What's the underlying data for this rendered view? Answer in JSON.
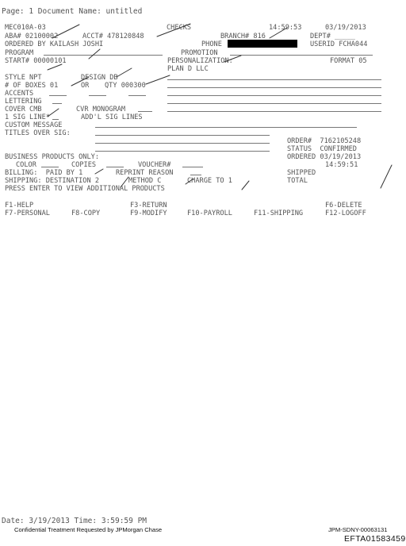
{
  "page_header": "Page: 1 Document Name: untitled",
  "screen": {
    "screen_id": "MEC010A-03",
    "section": "CHECKS",
    "time": "14:59:53",
    "date": "03/19/2013",
    "aba": "ABA# 02100002",
    "acct": "ACCT# 478120848",
    "branch": "BRANCH# 816",
    "dept": "DEPT# _____",
    "ordered_by": "ORDERED BY KAILASH JOSHI",
    "phone_label": "PHONE",
    "userid": "USERID FCHA044",
    "program": "PROGRAM",
    "promotion": "PROMOTION",
    "start": "START# 00000101",
    "personalization": "PERSONALIZATION:",
    "format": "FORMAT 05",
    "plan": "PLAN D LLC",
    "style": "STYLE NPT",
    "design": "DESIGN DB",
    "boxes": "# OF BOXES 01",
    "or": "OR",
    "qty": "QTY 000300",
    "accents": "ACCENTS",
    "lettering": "LETTERING",
    "cover": "COVER CMB",
    "monogram": "CVR MONOGRAM",
    "sig_line": "1 SIG LINE*",
    "addl_sig": "ADD'L SIG LINES",
    "custom_message": "CUSTOM MESSAGE",
    "titles_over_sig": "TITLES OVER SIG:",
    "order_num": "ORDER#  7162105248",
    "status": "STATUS  CONFIRMED",
    "ordered": "ORDERED 03/19/2013",
    "ordered_time": "14:59:51",
    "shipped": "SHIPPED",
    "total": "TOTAL",
    "business_products": "BUSINESS PRODUCTS ONLY:",
    "color": "COLOR",
    "copies": "COPIES",
    "voucher": "VOUCHER#",
    "billing": "BILLING:  PAID BY 1",
    "reprint": "REPRINT REASON",
    "shipping": "SHIPPING: DESTINATION 2",
    "method": "METHOD C",
    "charge_to": "CHARGE TO 1",
    "press_enter": "PRESS ENTER TO VIEW ADDITIONAL PRODUCTS"
  },
  "function_keys": {
    "f1": "F1-HELP",
    "f3": "F3-RETURN",
    "f6": "F6-DELETE",
    "f7": "F7-PERSONAL",
    "f8": "F8-COPY",
    "f9": "F9-MODIFY",
    "f10": "F10-PAYROLL",
    "f11": "F11-SHIPPING",
    "f12": "F12-LOGOFF"
  },
  "footer": {
    "date_time": "Date: 3/19/2013 Time: 3:59:59 PM",
    "confidential": "Confidential Treatment Requested by JPMorgan Chase",
    "doc_id": "JPM-SDNY-00063131",
    "bates": "EFTA01583459"
  },
  "colors": {
    "text": "#555555",
    "redaction": "#000000",
    "footer_text": "#111111"
  }
}
